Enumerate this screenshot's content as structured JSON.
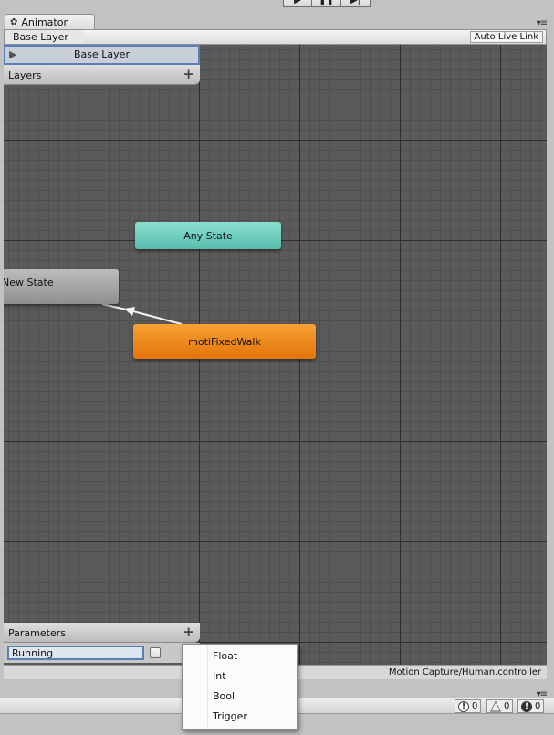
{
  "window": {
    "tab_title": "Animator"
  },
  "breadcrumb": {
    "current": "Base Layer",
    "auto_live_link": "Auto Live Link"
  },
  "layers": {
    "header": "Layers",
    "items": [
      {
        "name": "Base Layer",
        "selected": true
      }
    ]
  },
  "states": {
    "any_state": "Any State",
    "new_state": "New State",
    "walk_state": "motiFixedWalk"
  },
  "parameters": {
    "header": "Parameters",
    "items": [
      {
        "name": "Running",
        "type": "Bool",
        "value": false
      }
    ]
  },
  "param_type_menu": {
    "options": [
      "Float",
      "Int",
      "Bool",
      "Trigger"
    ]
  },
  "status": {
    "controller_path": "Motion Capture/Human.controller"
  },
  "console": {
    "info_count": "0",
    "warning_count": "0",
    "error_count": "0"
  },
  "colors": {
    "any_state": "#6fd0c0",
    "default_state": "#a7a7a7",
    "selected_state": "#ef8a1c",
    "selection_outline": "#5a7fb6",
    "graph_bg": "#5a5a5a"
  }
}
